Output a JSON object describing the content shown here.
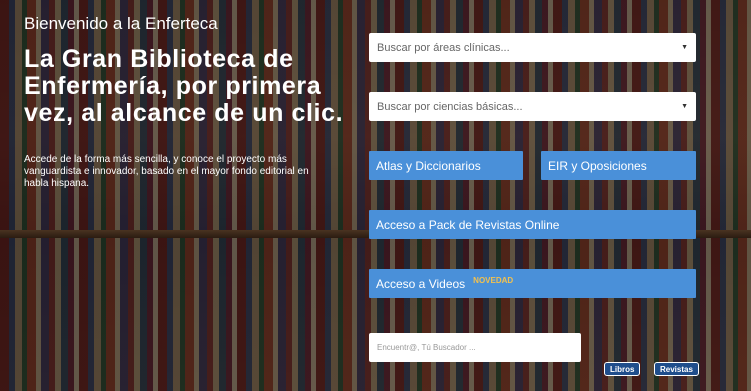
{
  "hero": {
    "welcome": "Bienvenido a la Enferteca",
    "headline": "La Gran Biblioteca de Enfermería, por primera vez, al alcance de un clic.",
    "subtext": "Accede de la forma más sencilla, y conoce el proyecto más vanguardista e innovador, basado en el mayor fondo editorial en habla hispana."
  },
  "search": {
    "clinical_placeholder": "Buscar por áreas clínicas...",
    "basic_placeholder": "Buscar por ciencias básicas...",
    "finder_placeholder": "Encuentr@, Tú Buscador ..."
  },
  "buttons": {
    "atlas": "Atlas y Diccionarios",
    "eir": "EIR y Oposiciones",
    "journals": "Acceso a Pack de Revistas Online",
    "videos": "Acceso a Videos",
    "videos_badge": "NOVEDAD",
    "books": "Libros",
    "magazines": "Revistas"
  },
  "colors": {
    "button_blue": "#4a90d9",
    "badge_yellow": "#f2c14e",
    "pill_blue": "#1f4e8c"
  },
  "icons": {
    "dropdown": "chevron-down-icon"
  }
}
